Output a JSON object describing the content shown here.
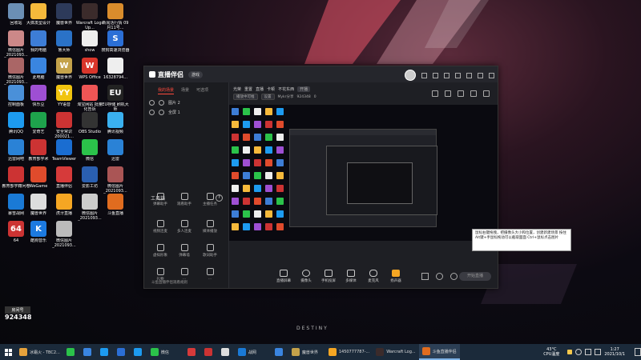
{
  "desktop": {
    "icons": [
      {
        "label": "回收站",
        "color": "#6b8fb5",
        "glyph": ""
      },
      {
        "label": "大搞发型设计",
        "color": "#f6b93b",
        "glyph": ""
      },
      {
        "label": "魔兽世界",
        "color": "#2d3a5a",
        "glyph": ""
      },
      {
        "label": "Warcraft Logs Up...",
        "color": "#3b2b2b",
        "glyph": ""
      },
      {
        "label": "新闻活行情 09月11号...",
        "color": "#d98c2c",
        "glyph": ""
      },
      {
        "label": "微信图片_2021093...",
        "color": "#c88",
        "glyph": ""
      },
      {
        "label": "我的电脑",
        "color": "#3d7dd6",
        "glyph": ""
      },
      {
        "label": "鲁大师",
        "color": "#2a72c7",
        "glyph": ""
      },
      {
        "label": "show",
        "color": "#eee",
        "glyph": ""
      },
      {
        "label": "搜狗高速浏览器",
        "color": "#2b6fd6",
        "glyph": "S"
      },
      {
        "label": "微信图片_2021093...",
        "color": "#a66",
        "glyph": ""
      },
      {
        "label": "此电脑",
        "color": "#3a85e0",
        "glyph": ""
      },
      {
        "label": "魔兽世界",
        "color": "#c4a24a",
        "glyph": "W"
      },
      {
        "label": "WPS Office",
        "color": "#d9362b",
        "glyph": "W"
      },
      {
        "label": "16328794...",
        "color": "#eee",
        "glyph": ""
      },
      {
        "label": "控制面板",
        "color": "#4a90d9",
        "glyph": ""
      },
      {
        "label": "快乐豆",
        "color": "#9e4fd3",
        "glyph": ""
      },
      {
        "label": "YY语音",
        "color": "#f1c40f",
        "glyph": "YY"
      },
      {
        "label": "淘宝网站 批量化告诉",
        "color": "#e55",
        "glyph": ""
      },
      {
        "label": "EU存储 刷机大师",
        "color": "#222",
        "glyph": "EU"
      },
      {
        "label": "腾讯QQ",
        "color": "#1d9bf0",
        "glyph": ""
      },
      {
        "label": "爱奇艺",
        "color": "#1ea34c",
        "glyph": ""
      },
      {
        "label": "安全常识 200021...",
        "color": "#c33",
        "glyph": ""
      },
      {
        "label": "OBS Studio",
        "color": "#333",
        "glyph": ""
      },
      {
        "label": "腾讯视频",
        "color": "#3ab0f0",
        "glyph": ""
      },
      {
        "label": "迅雷网吧",
        "color": "#2a82d6",
        "glyph": ""
      },
      {
        "label": "教育部学术",
        "color": "#c33",
        "glyph": ""
      },
      {
        "label": "TeamViewer",
        "color": "#1a6dd1",
        "glyph": ""
      },
      {
        "label": "微信",
        "color": "#2bc24a",
        "glyph": ""
      },
      {
        "label": "迅雷",
        "color": "#2a82d6",
        "glyph": ""
      },
      {
        "label": "教育部学籍问卷",
        "color": "#c33",
        "glyph": ""
      },
      {
        "label": "WeGame",
        "color": "#e04b2c",
        "glyph": ""
      },
      {
        "label": "直播伴侣",
        "color": "#d63a3a",
        "glyph": ""
      },
      {
        "label": "爱影工坊",
        "color": "#2a5fb0",
        "glyph": ""
      },
      {
        "label": "微信图片_2021093...",
        "color": "#a55",
        "glyph": ""
      },
      {
        "label": "暴雪战网",
        "color": "#1a7ad6",
        "glyph": ""
      },
      {
        "label": "魔兽世界",
        "color": "#ddd",
        "glyph": ""
      },
      {
        "label": "虎牙直播",
        "color": "#f5a623",
        "glyph": ""
      },
      {
        "label": "微信图片_2021093...",
        "color": "#ccc",
        "glyph": ""
      },
      {
        "label": "斗鱼直播",
        "color": "#e06c1f",
        "glyph": ""
      },
      {
        "label": "64",
        "color": "#c33",
        "glyph": "64"
      },
      {
        "label": "酷狗音乐",
        "color": "#1c7ae0",
        "glyph": "K"
      },
      {
        "label": "微信图片_2021093...",
        "color": "#bbb",
        "glyph": ""
      }
    ],
    "room": {
      "label": "房间号",
      "number": "924348"
    },
    "watermark": "DESTINY"
  },
  "window": {
    "app_name": "直播伴侣",
    "version_pill": "游戏",
    "left_tabs": [
      "我的场景",
      "场景",
      "可选项"
    ],
    "scenes": [
      "图片 2",
      "全屏 1"
    ],
    "tools_title": "工具箱",
    "tools": [
      "弹幕助手",
      "观看助手",
      "主播任务",
      "视频连麦",
      "多人连麦",
      "媒体播放",
      "虚拟形象",
      "弹幕墙",
      "歌词助手",
      "礼物",
      "…",
      "…"
    ],
    "notice": "斗鱼直播伴侣观看规则",
    "top_tags": [
      "光荣",
      "重置",
      "直播",
      "卡顿",
      "不花东西"
    ],
    "top_badge": "开播",
    "stats_row": [
      "播放中可推",
      "设置",
      "Mykr分享",
      "924348",
      "0"
    ],
    "bottom_buttons": [
      "直播屏幕",
      "摄像头",
      "手机投屏",
      "多媒体",
      "麦克风",
      "扬声器"
    ],
    "start_label": "开始直播"
  },
  "tooltip": {
    "text": "鼠标右键拖拽，把摄像头大小和位置，创建新建场景 按住Alt键+手鼠标拖动可以截取面面 Ctrl+鼠标点击图片"
  },
  "taskbar": {
    "items": [
      "冰霜火 - TBC2...",
      "",
      "",
      "",
      "",
      "",
      "微信",
      "",
      "",
      "",
      "战网",
      "",
      "魔兽世界",
      "1450777787-...",
      "Warcraft Log...",
      "斗鱼直播伴侣"
    ],
    "temp": "43°C",
    "temp_label": "CPU温度",
    "time": "1:27",
    "date": "2021/10/1"
  }
}
